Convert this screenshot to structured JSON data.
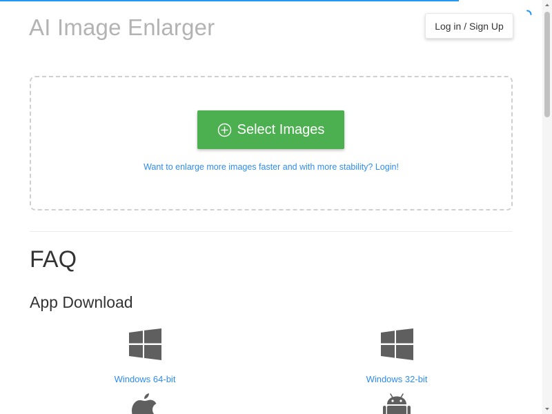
{
  "header": {
    "title": "AI Image Enlarger",
    "login_label": "Log in / Sign Up"
  },
  "upload": {
    "select_label": "Select Images",
    "login_hint": "Want to enlarge more images faster and with more stability? Login!"
  },
  "faq": {
    "title": "FAQ"
  },
  "app_download": {
    "title": "App Download",
    "items": [
      {
        "label": "Windows 64-bit",
        "icon": "windows-icon"
      },
      {
        "label": "Windows 32-bit",
        "icon": "windows-icon"
      },
      {
        "label": "",
        "icon": "apple-icon"
      },
      {
        "label": "",
        "icon": "android-icon"
      }
    ]
  },
  "colors": {
    "accent_green": "#4caf50",
    "link_blue": "#2d8cf0",
    "title_gray": "#b3b3b3",
    "icon_gray": "#5f5f5f"
  }
}
